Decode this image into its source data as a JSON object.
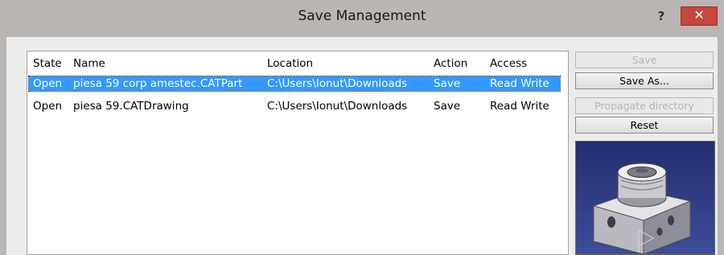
{
  "window": {
    "title": "Save Management",
    "help_label": "?",
    "close_label": "✕"
  },
  "table": {
    "columns": [
      "State",
      "Name",
      "Location",
      "Action",
      "Access"
    ],
    "rows": [
      {
        "state": "Open",
        "name": "piesa 59 corp amestec.CATPart",
        "location": "C:\\Users\\Ionut\\Downloads",
        "action": "Save",
        "access": "Read Write",
        "selected": true
      },
      {
        "state": "Open",
        "name": "piesa 59.CATDrawing",
        "location": "C:\\Users\\Ionut\\Downloads",
        "action": "Save",
        "access": "Read Write",
        "selected": false
      }
    ]
  },
  "buttons": {
    "save": {
      "label": "Save",
      "enabled": false
    },
    "save_as": {
      "label": "Save As...",
      "enabled": true
    },
    "propagate": {
      "label": "Propagate directory",
      "enabled": false
    },
    "reset": {
      "label": "Reset",
      "enabled": true
    }
  },
  "preview": {
    "icon": "catpart-3d-thumbnail",
    "background_color": "#2b3a82"
  },
  "colors": {
    "selection": "#3399ff",
    "close_button": "#c7463f"
  }
}
